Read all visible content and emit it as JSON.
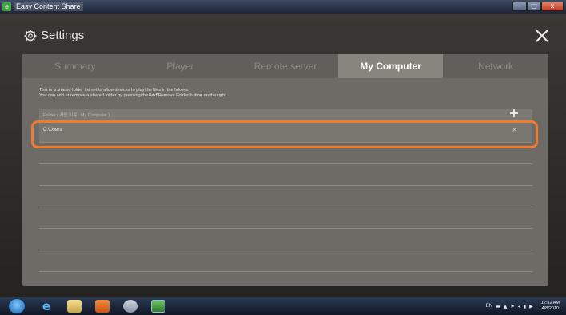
{
  "window": {
    "title": "Easy Content Share",
    "controls": {
      "minimize": "–",
      "maximize": "□",
      "close": "x"
    }
  },
  "settings": {
    "title": "Settings",
    "close_icon": "close-icon",
    "gear_icon": "gear-icon"
  },
  "tabs": [
    {
      "label": "Summary",
      "active": false
    },
    {
      "label": "Player",
      "active": false
    },
    {
      "label": "Remote server",
      "active": false
    },
    {
      "label": "My Computer",
      "active": true
    },
    {
      "label": "Network",
      "active": false
    }
  ],
  "description": {
    "line1": "This is a shared folder list set to allow devices to play the files in the folders.",
    "line2": "You can add or remove a shared folder by pressing the Add/Remove Folder button on the right."
  },
  "folder_list": {
    "header": "Folder ( 사용 이름 : My Computer )",
    "add_icon": "add-folder-icon",
    "folders": [
      {
        "path": "C:\\Users",
        "remove_label": "×"
      }
    ]
  },
  "taskbar": {
    "language": "EN",
    "clock_time": "12:52 AM",
    "clock_date": "4/8/2010"
  },
  "colors": {
    "highlight": "#ef7a32",
    "active_tab": "#88857f",
    "panel": "#6e6b66"
  }
}
